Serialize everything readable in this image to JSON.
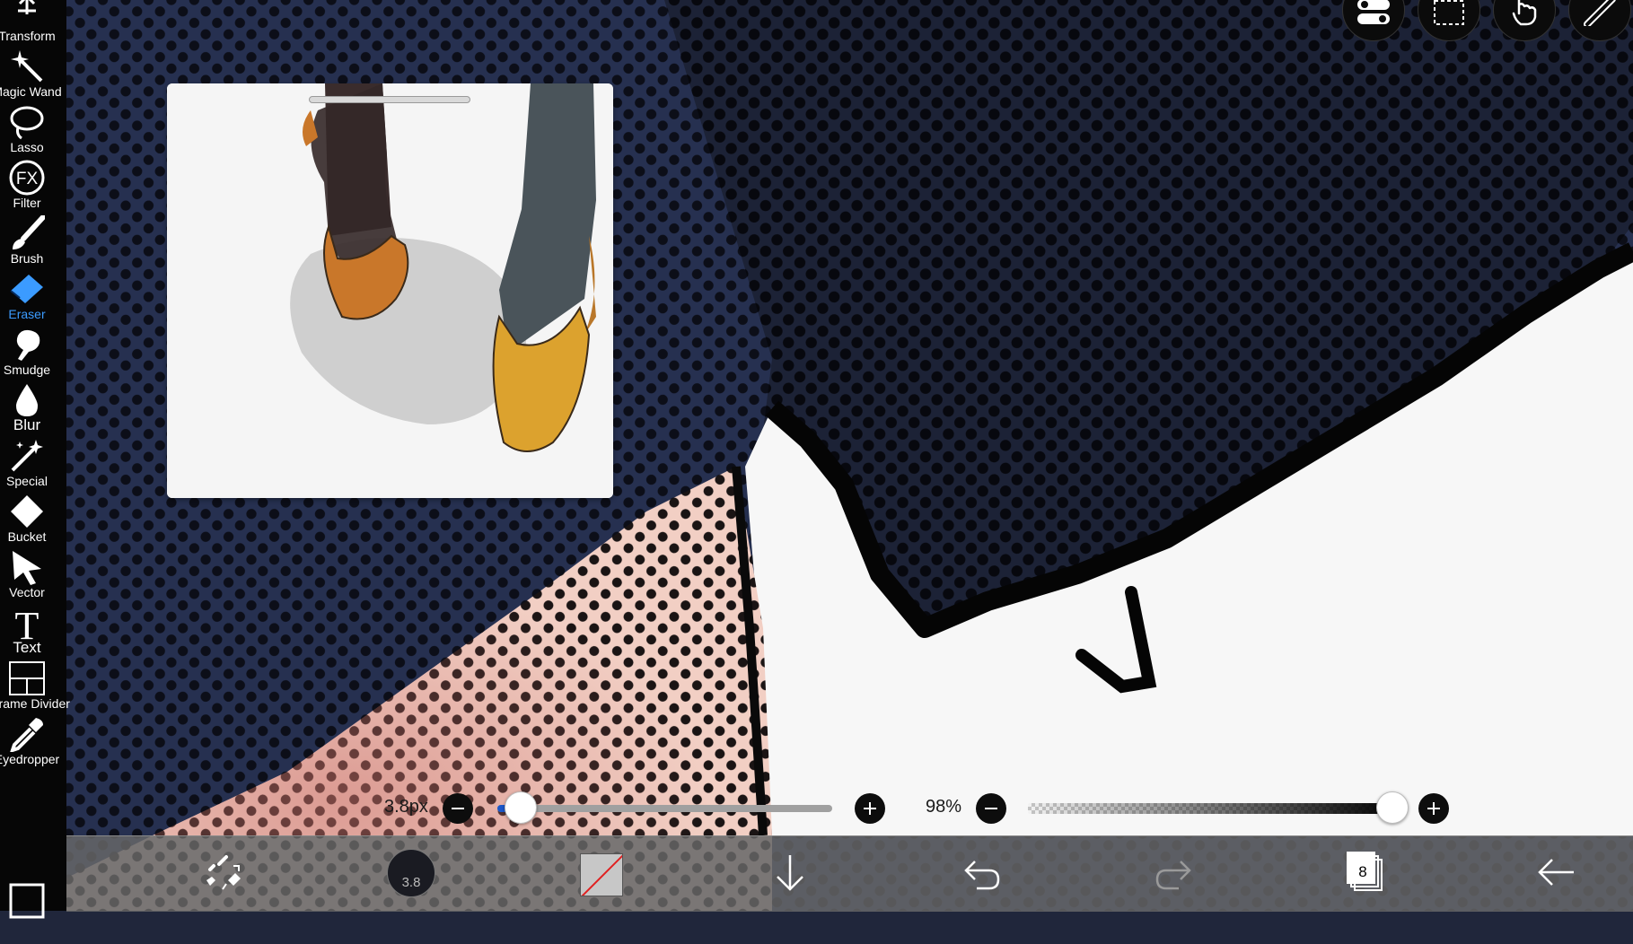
{
  "toolbar": {
    "active_tool": "Eraser",
    "accent_color": "#3b9bff",
    "items": [
      {
        "label": "Transform",
        "icon": "transform-icon"
      },
      {
        "label": "Magic Wand",
        "icon": "magic-wand-icon"
      },
      {
        "label": "Lasso",
        "icon": "lasso-icon"
      },
      {
        "label": "Filter",
        "icon": "filter-fx-icon"
      },
      {
        "label": "Brush",
        "icon": "brush-icon"
      },
      {
        "label": "Eraser",
        "icon": "eraser-icon"
      },
      {
        "label": "Smudge",
        "icon": "smudge-icon"
      },
      {
        "label": "Blur",
        "icon": "blur-drop-icon"
      },
      {
        "label": "Special",
        "icon": "special-wand-icon"
      },
      {
        "label": "Bucket",
        "icon": "bucket-icon"
      },
      {
        "label": "Vector",
        "icon": "vector-arrow-icon"
      },
      {
        "label": "Text",
        "icon": "text-icon"
      },
      {
        "label": "Frame Divider",
        "icon": "frame-divider-icon"
      },
      {
        "label": "Eyedropper",
        "icon": "eyedropper-icon"
      },
      {
        "label": "",
        "icon": "canvas-icon"
      }
    ]
  },
  "top_buttons": [
    {
      "icon": "toggle-switch-icon"
    },
    {
      "icon": "selection-marquee-icon"
    },
    {
      "icon": "hand-pointer-icon"
    },
    {
      "icon": "ruler-icon"
    }
  ],
  "sliders": {
    "brush_size": {
      "label": "3.8px",
      "fraction": 0.07
    },
    "opacity": {
      "label": "98%",
      "fraction": 0.98
    }
  },
  "bottom_bar": {
    "brush_size_badge": "3.8",
    "layers_count": "8",
    "items": [
      {
        "icon": "brush-settings-icon"
      },
      {
        "icon": "brush-size-icon"
      },
      {
        "icon": "color-swatch-icon"
      },
      {
        "icon": "download-arrow-icon"
      },
      {
        "icon": "undo-icon"
      },
      {
        "icon": "redo-icon"
      },
      {
        "icon": "layers-icon"
      },
      {
        "icon": "back-arrow-icon"
      }
    ]
  },
  "colors": {
    "toolbar_bg": "#060606",
    "active_accent": "#3b9bff",
    "slider_fill": "#1b57c9",
    "bottom_bar_bg": "#6a6a6a"
  }
}
